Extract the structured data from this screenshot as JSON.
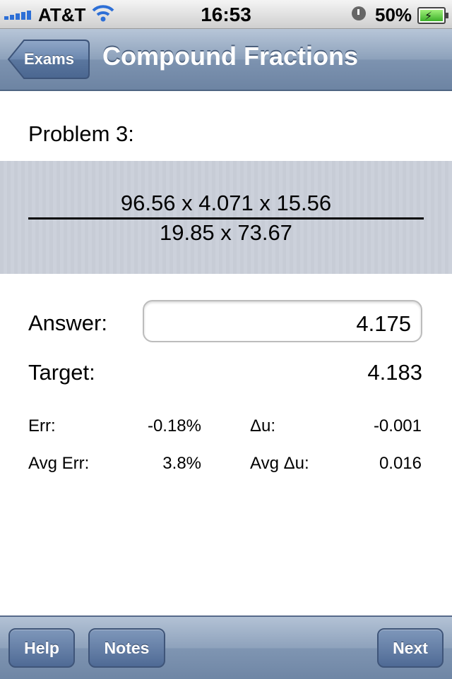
{
  "status_bar": {
    "carrier": "AT&T",
    "time": "16:53",
    "battery_percent": "50%",
    "signal_bars": 5,
    "wifi": true,
    "alarm": true,
    "battery_level": 0.5
  },
  "nav": {
    "back_label": "Exams",
    "title": "Compound Fractions"
  },
  "problem": {
    "label": "Problem 3:",
    "numerator": "96.56 x 4.071 x 15.56",
    "denominator": "19.85 x 73.67"
  },
  "answer": {
    "label": "Answer:",
    "value": "4.175"
  },
  "target": {
    "label": "Target:",
    "value": "4.183"
  },
  "stats": {
    "err_label": "Err:",
    "err_value": "-0.18%",
    "du_label": "Δu:",
    "du_value": "-0.001",
    "avg_err_label": "Avg Err:",
    "avg_err_value": "3.8%",
    "avg_du_label": "Avg Δu:",
    "avg_du_value": "0.016"
  },
  "toolbar": {
    "help_label": "Help",
    "notes_label": "Notes",
    "next_label": "Next"
  },
  "colors": {
    "accent_blue": "#2d6fd6",
    "navbar": "#8da1bb",
    "toolbar_button": "#4f6a95"
  }
}
